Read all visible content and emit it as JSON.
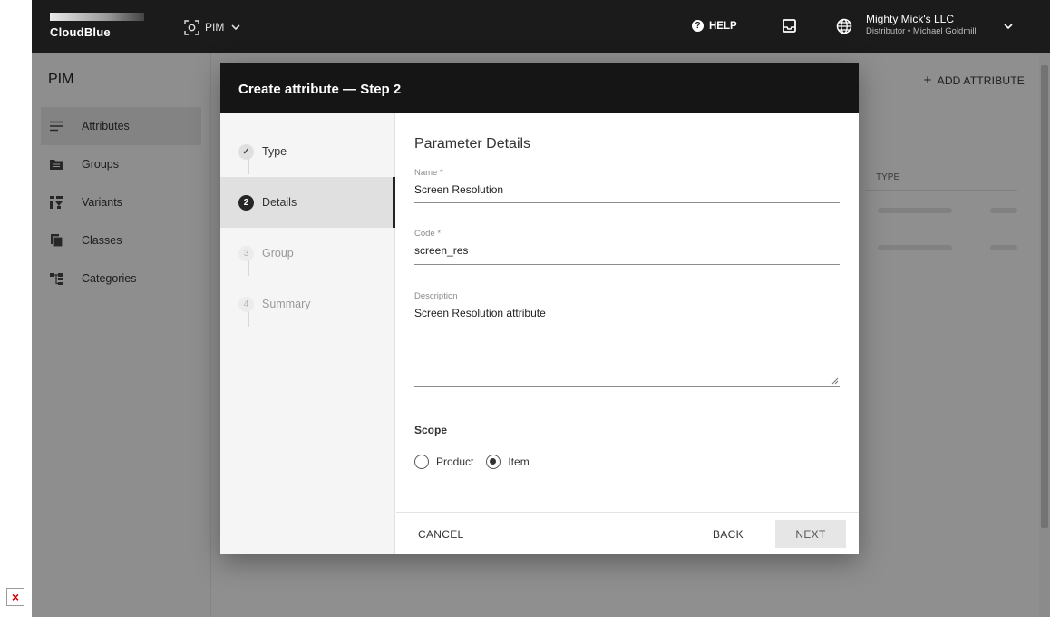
{
  "header": {
    "logo_text": "CloudBlue",
    "module_label": "PIM",
    "help_label": "HELP",
    "account_name": "Mighty Mick's LLC",
    "account_sub": "Distributor • Michael Goldmill"
  },
  "sidebar": {
    "title": "PIM",
    "items": [
      {
        "label": "Attributes",
        "icon": "list-icon",
        "active": true
      },
      {
        "label": "Groups",
        "icon": "folder-icon",
        "active": false
      },
      {
        "label": "Variants",
        "icon": "variants-icon",
        "active": false
      },
      {
        "label": "Classes",
        "icon": "classes-icon",
        "active": false
      },
      {
        "label": "Categories",
        "icon": "categories-icon",
        "active": false
      }
    ]
  },
  "content": {
    "add_attribute_label": "ADD ATTRIBUTE",
    "table_header_type": "TYPE"
  },
  "dialog": {
    "title": "Create attribute — Step 2",
    "steps": [
      {
        "marker": "✓",
        "label": "Type",
        "state": "done"
      },
      {
        "marker": "2",
        "label": "Details",
        "state": "active"
      },
      {
        "marker": "3",
        "label": "Group",
        "state": "todo"
      },
      {
        "marker": "4",
        "label": "Summary",
        "state": "todo"
      }
    ],
    "section_title": "Parameter Details",
    "fields": {
      "name_label": "Name *",
      "name_value": "Screen Resolution",
      "code_label": "Code *",
      "code_value": "screen_res",
      "description_label": "Description",
      "description_value": "Screen Resolution attribute"
    },
    "scope": {
      "label": "Scope",
      "options": [
        {
          "label": "Product",
          "selected": false
        },
        {
          "label": "Item",
          "selected": true
        }
      ]
    },
    "buttons": {
      "cancel": "CANCEL",
      "back": "BACK",
      "next": "NEXT"
    }
  },
  "colors": {
    "topbar_bg": "#1b1b1b",
    "dialog_header_bg": "#151515",
    "overlay": "rgba(0,0,0,0.42)"
  }
}
